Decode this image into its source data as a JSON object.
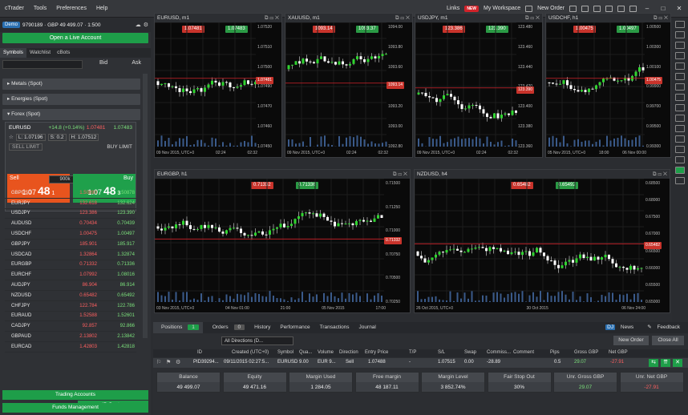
{
  "menu": {
    "items": [
      "cTrader",
      "Tools",
      "Preferences",
      "Help"
    ],
    "links": "Links",
    "new_badge": "NEW",
    "workspace": "My Workspace",
    "new_order": "New Order"
  },
  "account": {
    "mode": "Demo",
    "text": "9790189 · GBP 49 499.07 · 1:500",
    "live_button": "Open a Live Account"
  },
  "left_tabs": [
    "Symbols",
    "Watchlist",
    "cBots"
  ],
  "bid_label": "Bid",
  "ask_label": "Ask",
  "categories": [
    "Metals (Spot)",
    "Energies (Spot)",
    "Forex (Spot)"
  ],
  "eurusd": {
    "name": "EURUSD",
    "change": "+14.8 (+0.14%)",
    "bid": "1.07481",
    "ask": "1.07483",
    "low": "L: 1.07196",
    "spread": "S: 0.2",
    "high": "H: 1.07512",
    "sell_limit": "SELL LIMIT",
    "buy_limit": "BUY LIMIT",
    "sell": "Sell",
    "buy": "Buy",
    "volume": "900k",
    "sell_price_a": "1.07",
    "sell_price_b": "48",
    "sell_price_c": "1",
    "buy_price_a": "1.07",
    "buy_price_b": "48",
    "buy_price_c": "3"
  },
  "symbols": [
    {
      "n": "GBPUSD",
      "b": "1.50890",
      "a": "1.50878"
    },
    {
      "n": "EURJPY",
      "b": "132.618",
      "a": "132.624"
    },
    {
      "n": "USDJPY",
      "b": "123.386",
      "a": "123.390"
    },
    {
      "n": "AUDUSD",
      "b": "0.70434",
      "a": "0.70439"
    },
    {
      "n": "USDCHF",
      "b": "1.00475",
      "a": "1.00497"
    },
    {
      "n": "GBPJPY",
      "b": "185.901",
      "a": "185.917"
    },
    {
      "n": "USDCAD",
      "b": "1.32864",
      "a": "1.32874"
    },
    {
      "n": "EURGBP",
      "b": "0.71332",
      "a": "0.71336"
    },
    {
      "n": "EURCHF",
      "b": "1.07992",
      "a": "1.08016"
    },
    {
      "n": "AUDJPY",
      "b": "86.904",
      "a": "86.914"
    },
    {
      "n": "NZDUSD",
      "b": "0.65482",
      "a": "0.65492"
    },
    {
      "n": "CHFJPY",
      "b": "122.784",
      "a": "122.786"
    },
    {
      "n": "EURAUD",
      "b": "1.52588",
      "a": "1.52601"
    },
    {
      "n": "CADJPY",
      "b": "92.857",
      "a": "92.866"
    },
    {
      "n": "GBPAUD",
      "b": "2.13802",
      "a": "2.13842"
    },
    {
      "n": "EURCAD",
      "b": "1.42803",
      "a": "1.42818"
    }
  ],
  "left_buttons": {
    "trading_accounts": "Trading Accounts",
    "ib_center": "IB Center",
    "funds": "Funds Management"
  },
  "charts": [
    {
      "title": "EURUSD, m1",
      "sell": "1.07481",
      "buy": "1.07483",
      "price_tag": "1.07481",
      "axis": [
        "1.07520",
        "1.07510",
        "1.07500",
        "1.07490",
        "1.07470",
        "1.07460",
        "1.07450"
      ],
      "time": [
        "09 Nov 2015, UTC+0",
        "02:24",
        "02:32"
      ]
    },
    {
      "title": "XAUUSD, m1",
      "sell": "1093.14",
      "buy": "1093.37",
      "price_tag": "1093.14",
      "blue_tag": "1093.37",
      "axis": [
        "1094.00",
        "1093.80",
        "1093.60",
        "1093.40",
        "1093.20",
        "1093.00",
        "1092.80"
      ],
      "time": [
        "09 Nov 2015, UTC+0",
        "02:24",
        "02:32"
      ]
    },
    {
      "title": "USDJPY, m1",
      "sell": "123.386",
      "buy": "123.390",
      "price_tag": "123.390",
      "red_tag": "123.386",
      "axis": [
        "123.480",
        "123.460",
        "123.440",
        "123.420",
        "123.400",
        "123.380",
        "123.360"
      ],
      "time": [
        "09 Nov 2015, UTC+0",
        "02:24",
        "02:32"
      ]
    },
    {
      "title": "USDCHF, h1",
      "sell": "1.00475",
      "buy": "1.00497",
      "price_tag": "1.00475",
      "axis": [
        "1.00500",
        "1.00300",
        "1.00100",
        "0.99900",
        "0.99700",
        "0.99500",
        "0.99300"
      ],
      "time": [
        "05 Nov 2015, UTC+0",
        "18:00",
        "06 Nov 00:00"
      ]
    },
    {
      "title": "EURGBP, h1",
      "sell": "0.71332",
      "buy": "0.71336",
      "price_tag": "0.71332",
      "axis": [
        "0.71500",
        "0.71250",
        "0.71000",
        "0.70750",
        "0.70500",
        "0.70250"
      ],
      "time": [
        "03 Nov 2015, UTC+0",
        "04 Nov 01:00",
        "21:00",
        "05 Nov 2015",
        "17:00"
      ]
    },
    {
      "title": "NZDUSD, h4",
      "sell": "0.65482",
      "buy": "0.65492",
      "price_tag": "0.65482",
      "axis": [
        "0.68500",
        "0.68000",
        "0.67500",
        "0.67000",
        "0.66500",
        "0.66000",
        "0.65500",
        "0.65000"
      ],
      "time": [
        "26 Oct 2015, UTC+0",
        "30 Oct 2015",
        "06 Nov 24:00"
      ]
    }
  ],
  "bottom": {
    "tabs": {
      "positions": "Positions",
      "positions_count": "1",
      "orders": "Orders",
      "orders_count": "0",
      "history": "History",
      "performance": "Performance",
      "transactions": "Transactions",
      "journal": "Journal",
      "news": "News",
      "feedback": "Feedback"
    },
    "filter": "All Directions (D...",
    "new_order": "New Order",
    "close_all": "Close All",
    "headers": [
      "ID",
      "Created (UTC+0)",
      "Symbol",
      "Qua...",
      "Volume",
      "Direction",
      "Entry Price",
      "T/P",
      "S/L",
      "Swap",
      "Commiss...",
      "Comment",
      "Pips",
      "Gross GBP",
      "Net GBP"
    ],
    "position": [
      "PID39294...",
      "09/11/2015 02:27:5...",
      "EURUSD",
      "9.00",
      "EUR 9...",
      "Sell",
      "1.07488",
      "-",
      "1.07515",
      "0.00",
      "-28.89",
      "",
      "0.5",
      "29.07",
      "-27.91"
    ],
    "summary": [
      {
        "h": "Balance",
        "v": "49 499.07"
      },
      {
        "h": "Equity",
        "v": "49 471.16"
      },
      {
        "h": "Margin Used",
        "v": "1 284.05"
      },
      {
        "h": "Free margin",
        "v": "48 187.11"
      },
      {
        "h": "Margin Level",
        "v": "3 852.74%"
      },
      {
        "h": "Fair Stop Out",
        "v": "30%"
      },
      {
        "h": "Unr. Gross GBP",
        "v": "29.07"
      },
      {
        "h": "Unr. Net GBP",
        "v": "-27.91"
      }
    ]
  },
  "colors": {
    "sell": "#e8541e",
    "buy": "#1fa04b",
    "accent_green": "#1e9e49",
    "red_tag": "#c8332b"
  }
}
